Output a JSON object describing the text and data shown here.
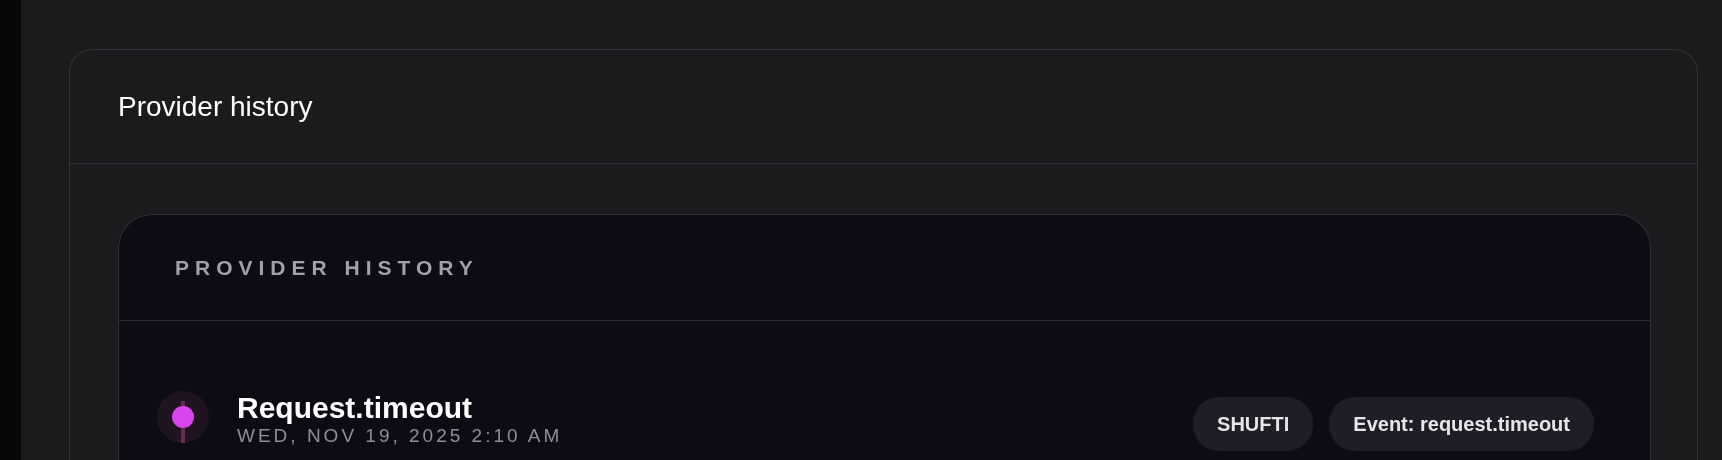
{
  "card": {
    "title": "Provider history"
  },
  "panel": {
    "heading": "PROVIDER HISTORY",
    "events": [
      {
        "title": "Request.timeout",
        "time": "WED, NOV 19, 2025 2:10 AM",
        "color": "#d946ef",
        "tags": [
          "SHUFTI",
          "Event: request.timeout"
        ]
      }
    ]
  }
}
